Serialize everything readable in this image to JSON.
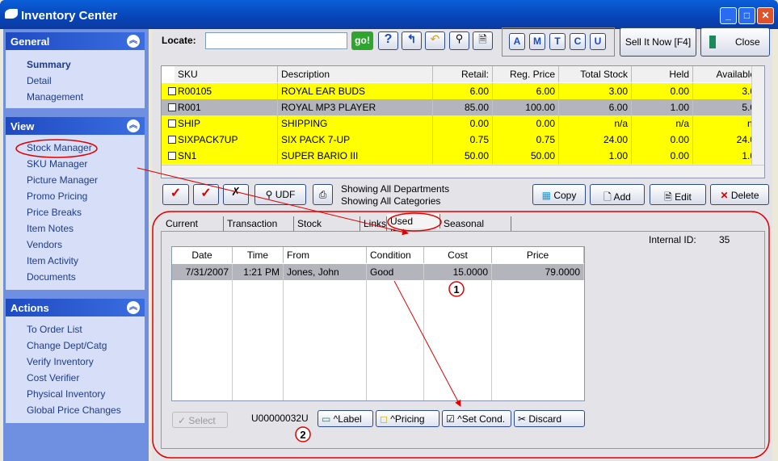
{
  "window": {
    "title": "Inventory Center",
    "minimize": "_",
    "maximize": "□",
    "close": "✕"
  },
  "sidebar": {
    "general": {
      "title": "General",
      "items": [
        {
          "label": "Summary"
        },
        {
          "label": "Detail"
        },
        {
          "label": "Management"
        }
      ]
    },
    "view": {
      "title": "View",
      "items": [
        {
          "label": "Stock Manager"
        },
        {
          "label": "SKU Manager"
        },
        {
          "label": "Picture Manager"
        },
        {
          "label": "Promo Pricing"
        },
        {
          "label": "Price Breaks"
        },
        {
          "label": "Item Notes"
        },
        {
          "label": "Vendors"
        },
        {
          "label": "Item Activity"
        },
        {
          "label": "Documents"
        }
      ]
    },
    "actions": {
      "title": "Actions",
      "items": [
        {
          "label": "To Order List"
        },
        {
          "label": "Change Dept/Catg"
        },
        {
          "label": "Verify Inventory"
        },
        {
          "label": "Cost Verifier"
        },
        {
          "label": "Physical Inventory"
        },
        {
          "label": "Global Price Changes"
        }
      ]
    }
  },
  "toolbar": {
    "locate_label": "Locate:",
    "locate_value": "",
    "go": "go!",
    "letters": [
      "A",
      "M",
      "T",
      "C",
      "U"
    ],
    "sell_it_now": "Sell It Now [F4]",
    "close": "Close"
  },
  "grid": {
    "columns": [
      "SKU",
      "Description",
      "Retail:",
      "Reg. Price",
      "Total Stock",
      "Held",
      "Available"
    ],
    "rows": [
      {
        "sku": "R00105",
        "desc": "ROYAL EAR BUDS",
        "retail": "6.00",
        "reg": "6.00",
        "total": "3.00",
        "held": "0.00",
        "avail": "3.0"
      },
      {
        "sku": "R001",
        "desc": "ROYAL MP3 PLAYER",
        "retail": "85.00",
        "reg": "100.00",
        "total": "6.00",
        "held": "1.00",
        "avail": "5.0"
      },
      {
        "sku": "SHIP",
        "desc": "SHIPPING",
        "retail": "0.00",
        "reg": "0.00",
        "total": "n/a",
        "held": "n/a",
        "avail": "n/"
      },
      {
        "sku": "SIXPACK7UP",
        "desc": "SIX PACK 7-UP",
        "retail": "0.75",
        "reg": "0.75",
        "total": "24.00",
        "held": "0.00",
        "avail": "24.0"
      },
      {
        "sku": "SN1",
        "desc": "SUPER BARIO III",
        "retail": "50.00",
        "reg": "50.00",
        "total": "1.00",
        "held": "0.00",
        "avail": "1.0"
      }
    ],
    "selected_row": 1,
    "row_color": "#ffff00",
    "selected_color": "#b4b4bc"
  },
  "actionbar": {
    "udf": "UDF",
    "showing_dept": "Showing All Departments",
    "showing_cat": "Showing All Categories",
    "copy": "Copy",
    "add": "Add",
    "edit": "Edit",
    "delete": "Delete"
  },
  "tabs": [
    {
      "label": "Current Stock"
    },
    {
      "label": "Transaction Log"
    },
    {
      "label": "Stock Location"
    },
    {
      "label": "Links"
    },
    {
      "label": "Used Items",
      "active": true
    },
    {
      "label": "Seasonal Levels"
    }
  ],
  "used_items": {
    "internal_id_label": "Internal ID:",
    "internal_id": "35",
    "columns": [
      "Date",
      "Time",
      "From",
      "Condition",
      "Cost",
      "Price"
    ],
    "rows": [
      {
        "date": "7/31/2007",
        "time": "1:21 PM",
        "from": "Jones, John",
        "condition": "Good",
        "cost": "15.0000",
        "price": "79.0000"
      }
    ],
    "select": "Select",
    "code": "U00000032U",
    "label": "^Label",
    "pricing": "^Pricing",
    "set_cond": "^Set Cond.",
    "discard": "Discard"
  },
  "annotations": {
    "callout1": "1",
    "callout2": "2",
    "color": "#e00000"
  }
}
